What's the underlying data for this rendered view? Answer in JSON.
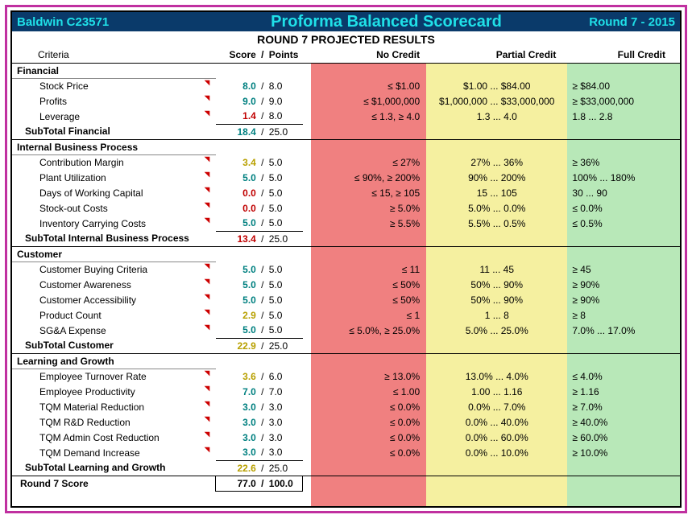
{
  "header": {
    "company": "Baldwin C23571",
    "title": "Proforma Balanced Scorecard",
    "round": "Round 7 - 2015"
  },
  "subtitle": "ROUND 7 PROJECTED RESULTS",
  "columns": {
    "criteria": "Criteria",
    "score": "Score",
    "slash": "/",
    "points": "Points",
    "no_credit": "No Credit",
    "partial_credit": "Partial Credit",
    "full_credit": "Full Credit"
  },
  "sections": {
    "financial": {
      "title": "Financial",
      "rows": {
        "stock_price": {
          "label": "Stock Price",
          "score": "8.0",
          "score_class": "teal",
          "points": "8.0",
          "no": "≤ $1.00",
          "partial": "$1.00 ... $84.00",
          "full": "≥ $84.00"
        },
        "profits": {
          "label": "Profits",
          "score": "9.0",
          "score_class": "teal",
          "points": "9.0",
          "no": "≤ $1,000,000",
          "partial": "$1,000,000 ... $33,000,000",
          "full": "≥ $33,000,000"
        },
        "leverage": {
          "label": "Leverage",
          "score": "1.4",
          "score_class": "red",
          "points": "8.0",
          "no": "≤ 1.3, ≥ 4.0",
          "partial": "1.3 ... 4.0",
          "full": "1.8 ... 2.8"
        }
      },
      "subtotal": {
        "label": "SubTotal Financial",
        "score": "18.4",
        "points": "25.0"
      }
    },
    "ibp": {
      "title": "Internal Business Process",
      "rows": {
        "contrib": {
          "label": "Contribution Margin",
          "score": "3.4",
          "score_class": "yellow",
          "points": "5.0",
          "no": "≤ 27%",
          "partial": "27% ... 36%",
          "full": "≥ 36%"
        },
        "plant": {
          "label": "Plant Utilization",
          "score": "5.0",
          "score_class": "teal",
          "points": "5.0",
          "no": "≤ 90%, ≥ 200%",
          "partial": "90% ... 200%",
          "full": "100% ... 180%"
        },
        "working": {
          "label": "Days of Working Capital",
          "score": "0.0",
          "score_class": "red",
          "points": "5.0",
          "no": "≤ 15, ≥ 105",
          "partial": "15 ... 105",
          "full": "30 ... 90"
        },
        "stockout": {
          "label": "Stock-out Costs",
          "score": "0.0",
          "score_class": "red",
          "points": "5.0",
          "no": "≥ 5.0%",
          "partial": "5.0% ... 0.0%",
          "full": "≤ 0.0%"
        },
        "inventory": {
          "label": "Inventory Carrying Costs",
          "score": "5.0",
          "score_class": "teal",
          "points": "5.0",
          "no": "≥ 5.5%",
          "partial": "5.5% ... 0.5%",
          "full": "≤ 0.5%"
        }
      },
      "subtotal": {
        "label": "SubTotal Internal Business Process",
        "score": "13.4",
        "points": "25.0"
      }
    },
    "customer": {
      "title": "Customer",
      "rows": {
        "buying": {
          "label": "Customer Buying Criteria",
          "score": "5.0",
          "score_class": "teal",
          "points": "5.0",
          "no": "≤ 11",
          "partial": "11 ... 45",
          "full": "≥ 45"
        },
        "aware": {
          "label": "Customer Awareness",
          "score": "5.0",
          "score_class": "teal",
          "points": "5.0",
          "no": "≤ 50%",
          "partial": "50% ... 90%",
          "full": "≥ 90%"
        },
        "access": {
          "label": "Customer Accessibility",
          "score": "5.0",
          "score_class": "teal",
          "points": "5.0",
          "no": "≤ 50%",
          "partial": "50% ... 90%",
          "full": "≥ 90%"
        },
        "product": {
          "label": "Product Count",
          "score": "2.9",
          "score_class": "yellow",
          "points": "5.0",
          "no": "≤ 1",
          "partial": "1 ... 8",
          "full": "≥ 8"
        },
        "sga": {
          "label": "SG&A Expense",
          "score": "5.0",
          "score_class": "teal",
          "points": "5.0",
          "no": "≤ 5.0%, ≥ 25.0%",
          "partial": "5.0% ... 25.0%",
          "full": "7.0% ... 17.0%"
        }
      },
      "subtotal": {
        "label": "SubTotal Customer",
        "score": "22.9",
        "points": "25.0"
      }
    },
    "learning": {
      "title": "Learning and Growth",
      "rows": {
        "turnover": {
          "label": "Employee Turnover Rate",
          "score": "3.6",
          "score_class": "yellow",
          "points": "6.0",
          "no": "≥ 13.0%",
          "partial": "13.0% ... 4.0%",
          "full": "≤ 4.0%"
        },
        "prod": {
          "label": "Employee Productivity",
          "score": "7.0",
          "score_class": "teal",
          "points": "7.0",
          "no": "≤ 1.00",
          "partial": "1.00 ... 1.16",
          "full": "≥ 1.16"
        },
        "material": {
          "label": "TQM Material Reduction",
          "score": "3.0",
          "score_class": "teal",
          "points": "3.0",
          "no": "≤ 0.0%",
          "partial": "0.0% ... 7.0%",
          "full": "≥ 7.0%"
        },
        "rd": {
          "label": "TQM R&D Reduction",
          "score": "3.0",
          "score_class": "teal",
          "points": "3.0",
          "no": "≤ 0.0%",
          "partial": "0.0% ... 40.0%",
          "full": "≥ 40.0%"
        },
        "admin": {
          "label": "TQM Admin Cost Reduction",
          "score": "3.0",
          "score_class": "teal",
          "points": "3.0",
          "no": "≤ 0.0%",
          "partial": "0.0% ... 60.0%",
          "full": "≥ 60.0%"
        },
        "demand": {
          "label": "TQM Demand Increase",
          "score": "3.0",
          "score_class": "teal",
          "points": "3.0",
          "no": "≤ 0.0%",
          "partial": "0.0% ... 10.0%",
          "full": "≥ 10.0%"
        }
      },
      "subtotal": {
        "label": "SubTotal Learning and Growth",
        "score": "22.6",
        "points": "25.0"
      }
    }
  },
  "grand": {
    "label": "Round 7 Score",
    "score": "77.0",
    "points": "100.0"
  }
}
